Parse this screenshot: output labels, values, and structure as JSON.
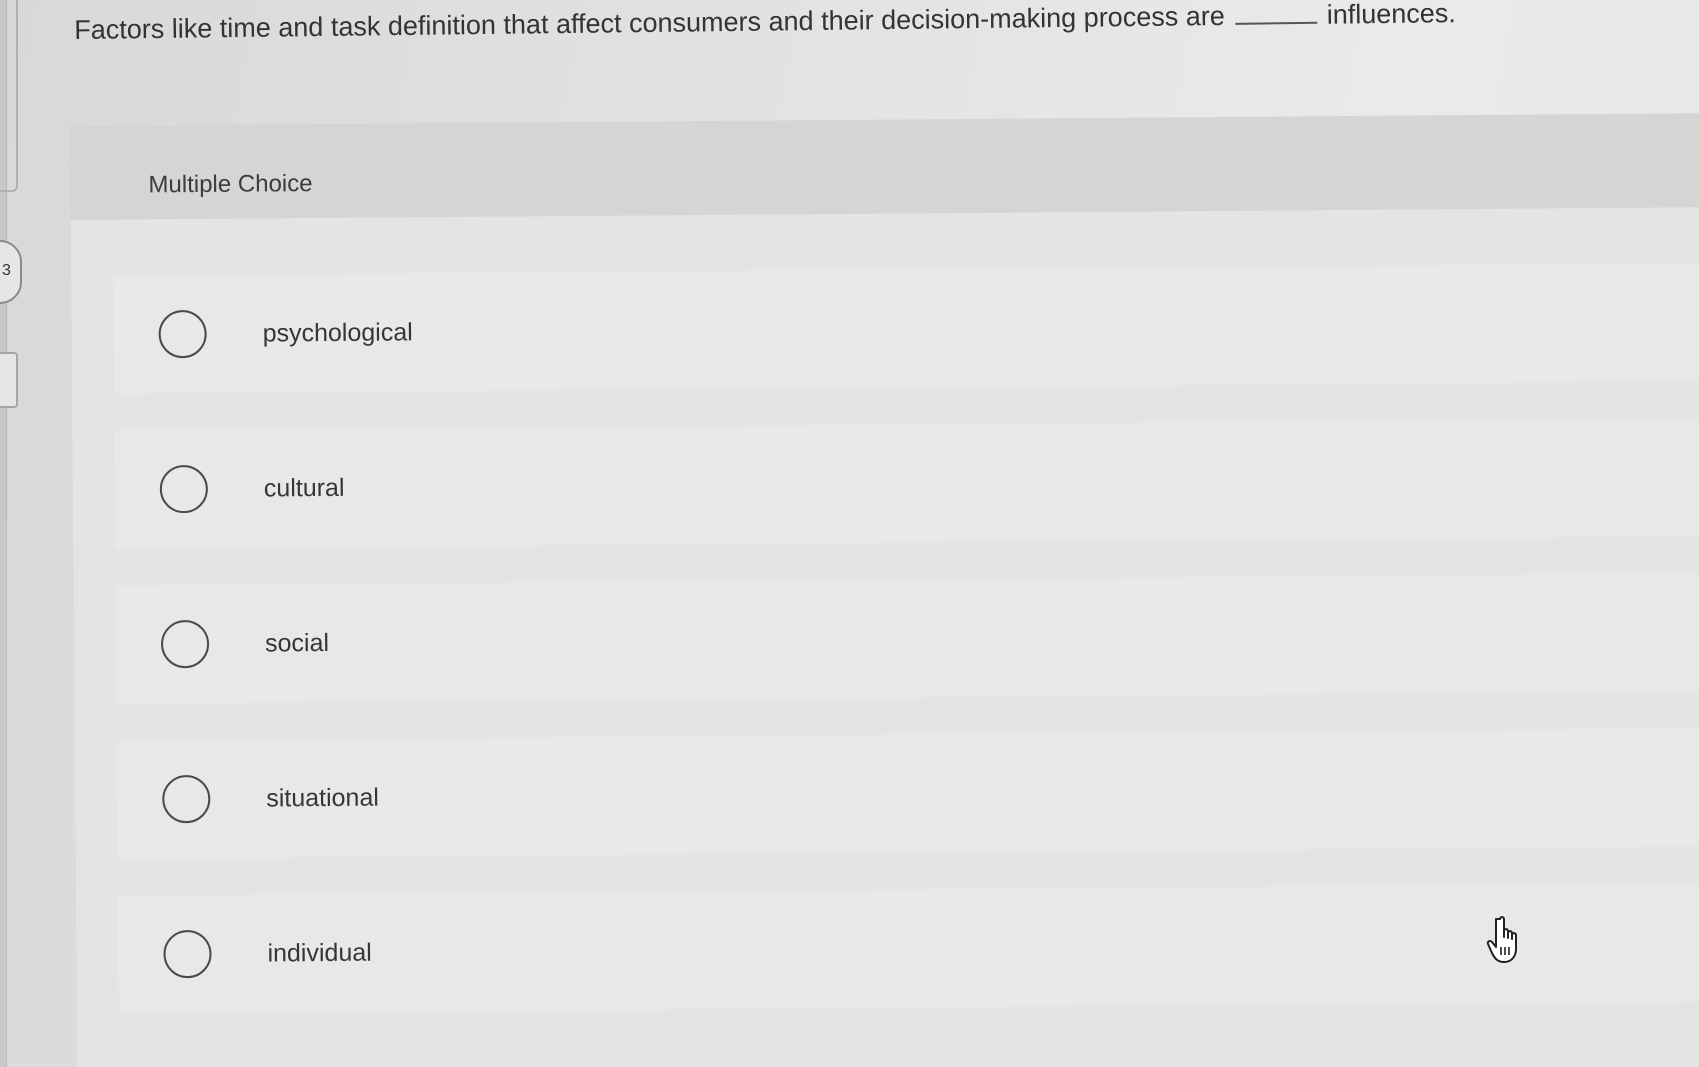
{
  "question": {
    "text_before": "Factors like time and task definition that affect consumers and their decision-making process are",
    "text_after": "influences."
  },
  "question_type": "Multiple Choice",
  "side_marker": "3",
  "options": [
    {
      "label": "psychological",
      "selected": false
    },
    {
      "label": "cultural",
      "selected": false
    },
    {
      "label": "social",
      "selected": false
    },
    {
      "label": "situational",
      "selected": false
    },
    {
      "label": "individual",
      "selected": false
    }
  ],
  "cursor_icon": "hand-pointer-icon"
}
